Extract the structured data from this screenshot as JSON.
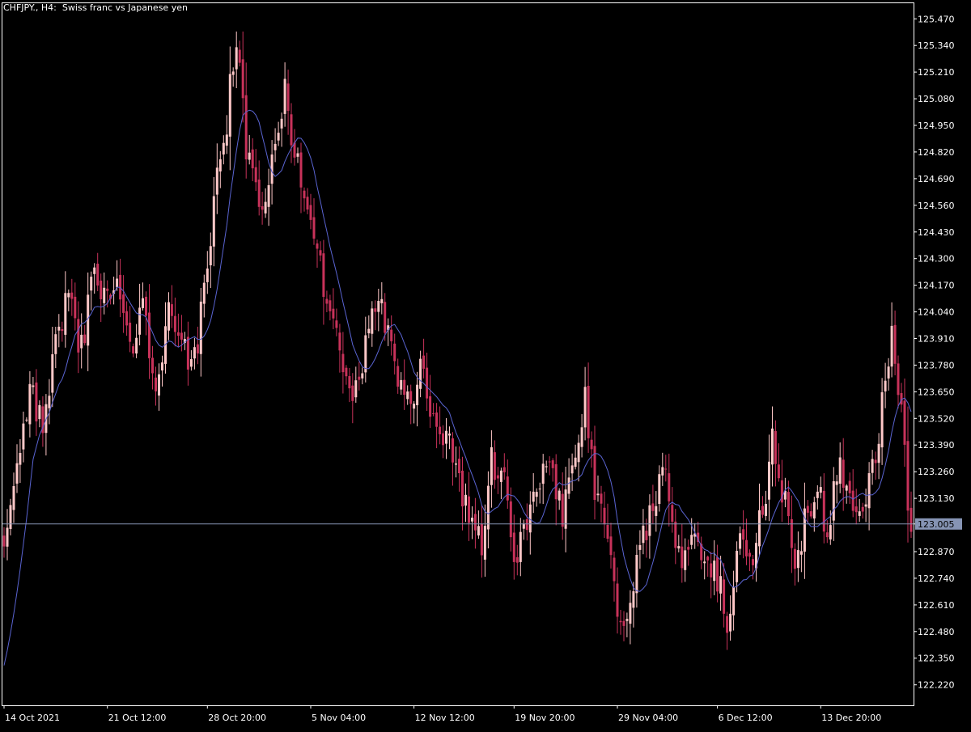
{
  "header": {
    "title": "CHFJPY., H4:  Swiss franc vs Japanese yen"
  },
  "colors": {
    "background": "#000000",
    "axis": "#ffffff",
    "bull_candle": "#ffc8c8",
    "bear_candle": "#c8325a",
    "moving_average": "#5a64d2",
    "bid_line": "#8694b4",
    "bid_label_bg": "#8694b4",
    "bid_label_text": "#000000"
  },
  "chart_data": {
    "type": "candlestick",
    "symbol": "CHFJPY.",
    "timeframe": "H4",
    "description": "Swiss franc vs Japanese yen",
    "ylim": [
      122.12,
      125.55
    ],
    "y_ticks": [
      "125.470",
      "125.340",
      "125.210",
      "125.080",
      "124.950",
      "124.820",
      "124.690",
      "124.560",
      "124.430",
      "124.300",
      "124.170",
      "124.040",
      "123.910",
      "123.780",
      "123.650",
      "123.520",
      "123.390",
      "123.260",
      "123.130",
      "123.005",
      "122.870",
      "122.740",
      "122.610",
      "122.480",
      "122.350",
      "122.220"
    ],
    "x_ticks": [
      {
        "label": "14 Oct 2021",
        "index": 0
      },
      {
        "label": "21 Oct 12:00",
        "index": 32
      },
      {
        "label": "28 Oct 20:00",
        "index": 63
      },
      {
        "label": "5 Nov 04:00",
        "index": 95
      },
      {
        "label": "12 Nov 12:00",
        "index": 127
      },
      {
        "label": "19 Nov 20:00",
        "index": 158
      },
      {
        "label": "29 Nov 04:00",
        "index": 190
      },
      {
        "label": "6 Dec 12:00",
        "index": 221
      },
      {
        "label": "13 Dec 20:00",
        "index": 253
      }
    ],
    "bid_price": "123.005",
    "bid_value": 123.005,
    "anchors": [
      {
        "i": 0,
        "p": 122.95
      },
      {
        "i": 4,
        "p": 123.3
      },
      {
        "i": 8,
        "p": 123.62
      },
      {
        "i": 12,
        "p": 123.5
      },
      {
        "i": 17,
        "p": 123.95
      },
      {
        "i": 20,
        "p": 124.2
      },
      {
        "i": 24,
        "p": 123.85
      },
      {
        "i": 28,
        "p": 124.25
      },
      {
        "i": 31,
        "p": 124.1
      },
      {
        "i": 35,
        "p": 124.2
      },
      {
        "i": 39,
        "p": 123.85
      },
      {
        "i": 43,
        "p": 124.1
      },
      {
        "i": 47,
        "p": 123.6
      },
      {
        "i": 51,
        "p": 124.05
      },
      {
        "i": 55,
        "p": 123.85
      },
      {
        "i": 59,
        "p": 123.8
      },
      {
        "i": 63,
        "p": 124.25
      },
      {
        "i": 67,
        "p": 124.8
      },
      {
        "i": 72,
        "p": 125.3
      },
      {
        "i": 76,
        "p": 124.75
      },
      {
        "i": 79,
        "p": 124.55
      },
      {
        "i": 84,
        "p": 124.8
      },
      {
        "i": 87,
        "p": 125.1
      },
      {
        "i": 90,
        "p": 124.8
      },
      {
        "i": 93,
        "p": 124.55
      },
      {
        "i": 97,
        "p": 124.3
      },
      {
        "i": 101,
        "p": 124.0
      },
      {
        "i": 104,
        "p": 123.85
      },
      {
        "i": 108,
        "p": 123.6
      },
      {
        "i": 112,
        "p": 123.85
      },
      {
        "i": 116,
        "p": 124.15
      },
      {
        "i": 119,
        "p": 123.95
      },
      {
        "i": 122,
        "p": 123.75
      },
      {
        "i": 126,
        "p": 123.6
      },
      {
        "i": 129,
        "p": 123.8
      },
      {
        "i": 133,
        "p": 123.55
      },
      {
        "i": 137,
        "p": 123.4
      },
      {
        "i": 141,
        "p": 123.2
      },
      {
        "i": 145,
        "p": 123.0
      },
      {
        "i": 148,
        "p": 122.9
      },
      {
        "i": 151,
        "p": 123.3
      },
      {
        "i": 155,
        "p": 123.2
      },
      {
        "i": 158,
        "p": 122.75
      },
      {
        "i": 162,
        "p": 123.05
      },
      {
        "i": 166,
        "p": 123.2
      },
      {
        "i": 169,
        "p": 123.3
      },
      {
        "i": 173,
        "p": 123.05
      },
      {
        "i": 177,
        "p": 123.4
      },
      {
        "i": 180,
        "p": 123.6
      },
      {
        "i": 183,
        "p": 123.2
      },
      {
        "i": 187,
        "p": 122.95
      },
      {
        "i": 190,
        "p": 122.55
      },
      {
        "i": 194,
        "p": 122.6
      },
      {
        "i": 197,
        "p": 122.9
      },
      {
        "i": 201,
        "p": 123.05
      },
      {
        "i": 204,
        "p": 123.3
      },
      {
        "i": 207,
        "p": 122.95
      },
      {
        "i": 211,
        "p": 122.8
      },
      {
        "i": 214,
        "p": 122.95
      },
      {
        "i": 217,
        "p": 122.8
      },
      {
        "i": 221,
        "p": 122.75
      },
      {
        "i": 224,
        "p": 122.55
      },
      {
        "i": 228,
        "p": 122.9
      },
      {
        "i": 232,
        "p": 122.8
      },
      {
        "i": 235,
        "p": 123.1
      },
      {
        "i": 238,
        "p": 123.4
      },
      {
        "i": 242,
        "p": 123.15
      },
      {
        "i": 245,
        "p": 122.85
      },
      {
        "i": 249,
        "p": 123.05
      },
      {
        "i": 252,
        "p": 123.15
      },
      {
        "i": 255,
        "p": 123.0
      },
      {
        "i": 259,
        "p": 123.3
      },
      {
        "i": 262,
        "p": 123.1
      },
      {
        "i": 266,
        "p": 123.05
      },
      {
        "i": 270,
        "p": 123.35
      },
      {
        "i": 273,
        "p": 123.75
      },
      {
        "i": 275,
        "p": 123.9
      },
      {
        "i": 278,
        "p": 123.55
      },
      {
        "i": 281,
        "p": 123.0
      }
    ],
    "n_candles": 282,
    "ma_period": 10,
    "ma_start": 122.25
  }
}
